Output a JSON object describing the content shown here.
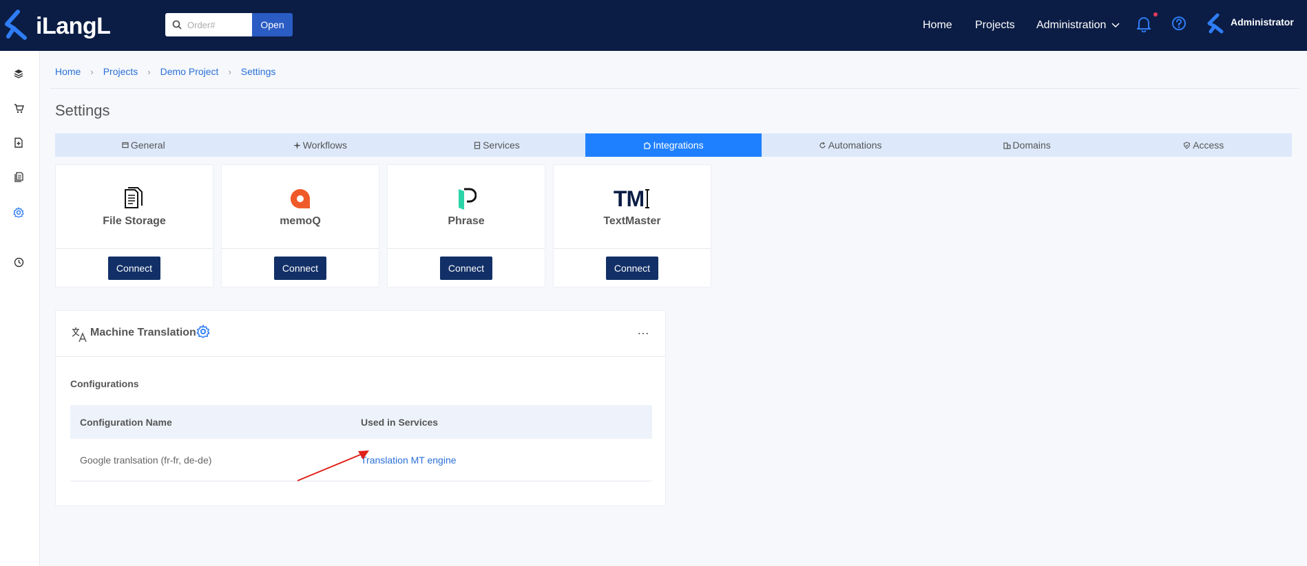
{
  "header": {
    "logo_text": "iLangL",
    "search_placeholder": "Order#",
    "open_label": "Open",
    "nav": {
      "home": "Home",
      "projects": "Projects",
      "administration": "Administration"
    },
    "user_name": "Administrator"
  },
  "breadcrumb": [
    "Home",
    "Projects",
    "Demo Project",
    "Settings"
  ],
  "page_title": "Settings",
  "tabs": [
    {
      "label": "General",
      "icon": "window-icon"
    },
    {
      "label": "Workflows",
      "icon": "workflow-icon"
    },
    {
      "label": "Services",
      "icon": "server-icon"
    },
    {
      "label": "Integrations",
      "icon": "puzzle-icon",
      "active": true
    },
    {
      "label": "Automations",
      "icon": "refresh-icon"
    },
    {
      "label": "Domains",
      "icon": "building-icon"
    },
    {
      "label": "Access",
      "icon": "shield-check-icon"
    }
  ],
  "integrations": [
    {
      "name": "File Storage",
      "button": "Connect"
    },
    {
      "name": "memoQ",
      "button": "Connect"
    },
    {
      "name": "Phrase",
      "button": "Connect"
    },
    {
      "name": "TextMaster",
      "button": "Connect",
      "logo_text": "TM"
    }
  ],
  "machine_translation": {
    "title": "Machine Translation",
    "more": "…",
    "configurations_label": "Configurations",
    "columns": [
      "Configuration Name",
      "Used in Services"
    ],
    "rows": [
      {
        "name": "Google tranlsation (fr-fr, de-de)",
        "service": "Translation MT engine"
      }
    ]
  },
  "colors": {
    "topbar": "#0b1d45",
    "accent": "#1f80ff",
    "button": "#123067",
    "link": "#2a6fd6",
    "annotation_arrow": "#e0201a"
  }
}
